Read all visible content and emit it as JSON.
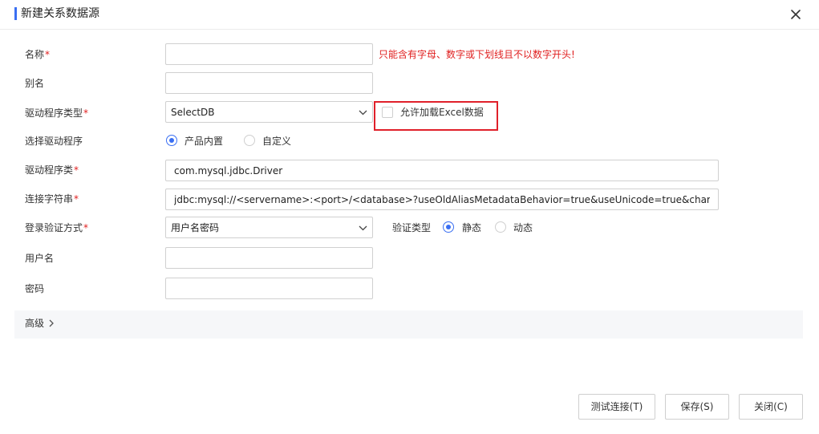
{
  "dialog": {
    "title": "新建关系数据源",
    "close_icon": "close-icon"
  },
  "form": {
    "name": {
      "label": "名称",
      "required_mark": "*",
      "value": "",
      "error": "只能含有字母、数字或下划线且不以数字开头!"
    },
    "alias": {
      "label": "别名",
      "value": ""
    },
    "driver_type": {
      "label": "驱动程序类型",
      "required_mark": "*",
      "selected": "SelectDB"
    },
    "allow_excel": {
      "label": "允许加载Excel数据",
      "checked": false
    },
    "driver_choice": {
      "label": "选择驱动程序",
      "options": [
        "产品内置",
        "自定义"
      ],
      "selected": "产品内置"
    },
    "driver_class": {
      "label": "驱动程序类",
      "required_mark": "*",
      "value": "com.mysql.jdbc.Driver"
    },
    "connection_string": {
      "label": "连接字符串",
      "required_mark": "*",
      "value": "jdbc:mysql://<servername>:<port>/<database>?useOldAliasMetadataBehavior=true&useUnicode=true&characterE"
    },
    "login_auth": {
      "label": "登录验证方式",
      "required_mark": "*",
      "selected": "用户名密码"
    },
    "auth_type": {
      "label": "验证类型",
      "options": [
        "静态",
        "动态"
      ],
      "selected": "静态"
    },
    "username": {
      "label": "用户名",
      "value": ""
    },
    "password": {
      "label": "密码",
      "value": ""
    }
  },
  "advanced": {
    "label": "高级"
  },
  "buttons": {
    "test": "测试连接(T)",
    "save": "保存(S)",
    "close": "关闭(C)"
  },
  "colors": {
    "accent": "#3a6ff2",
    "error": "#e02020",
    "highlight": "#e0202a"
  }
}
